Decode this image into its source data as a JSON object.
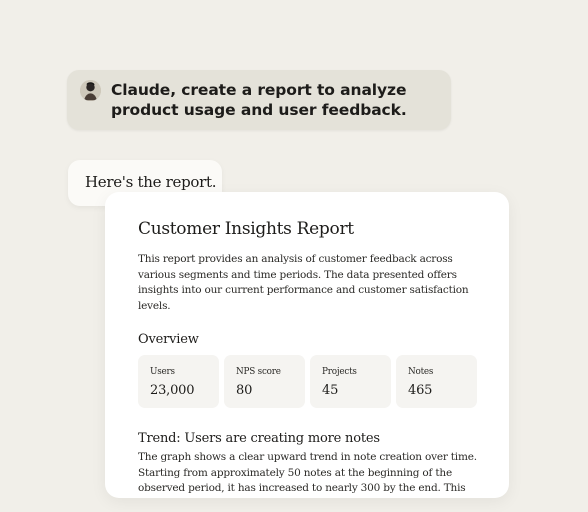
{
  "conversation": {
    "user_message": "Claude, create a report to analyze product usage and user feedback.",
    "assistant_message": "Here's the report."
  },
  "report": {
    "title": "Customer Insights Report",
    "intro": "This report provides an analysis of customer feedback across various segments and time periods. The data presented offers insights into our current performance and customer satisfaction levels.",
    "overview_heading": "Overview",
    "metrics": [
      {
        "label": "Users",
        "value": "23,000"
      },
      {
        "label": "NPS score",
        "value": "80"
      },
      {
        "label": "Projects",
        "value": "45"
      },
      {
        "label": "Notes",
        "value": "465"
      }
    ],
    "trend_heading": "Trend: Users are creating more notes",
    "trend_text": "The graph shows a clear upward trend in note creation over time. Starting from approximately 50 notes at the beginning of the observed period, it has increased to nearly 300 by the end. This"
  },
  "colors": {
    "background": "#f1efe9",
    "user_bubble": "#e4e2d9",
    "assistant_bubble": "#fbfaf7",
    "card": "#ffffff",
    "metric_tile": "#f5f4f1",
    "text": "#1d1c1a"
  },
  "icons": {
    "avatar": "user-avatar-icon"
  }
}
